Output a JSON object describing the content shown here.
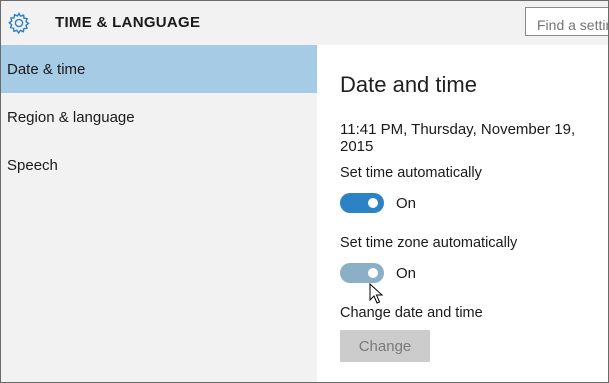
{
  "header": {
    "title": "TIME & LANGUAGE",
    "search_placeholder": "Find a setting"
  },
  "sidebar": {
    "items": [
      {
        "label": "Date & time",
        "selected": true
      },
      {
        "label": "Region & language",
        "selected": false
      },
      {
        "label": "Speech",
        "selected": false
      }
    ]
  },
  "main": {
    "title": "Date and time",
    "current_datetime": "11:41 PM, Thursday, November 19, 2015",
    "set_time_auto": {
      "label": "Set time automatically",
      "state": "On",
      "on": true,
      "color": "#2b83c6"
    },
    "set_timezone_auto": {
      "label": "Set time zone automatically",
      "state": "On",
      "on": true,
      "color": "#8aafc7"
    },
    "change_section_label": "Change date and time",
    "change_button_label": "Change"
  },
  "icons": {
    "settings": "gear-icon",
    "cursor": "mouse-pointer-icon"
  }
}
